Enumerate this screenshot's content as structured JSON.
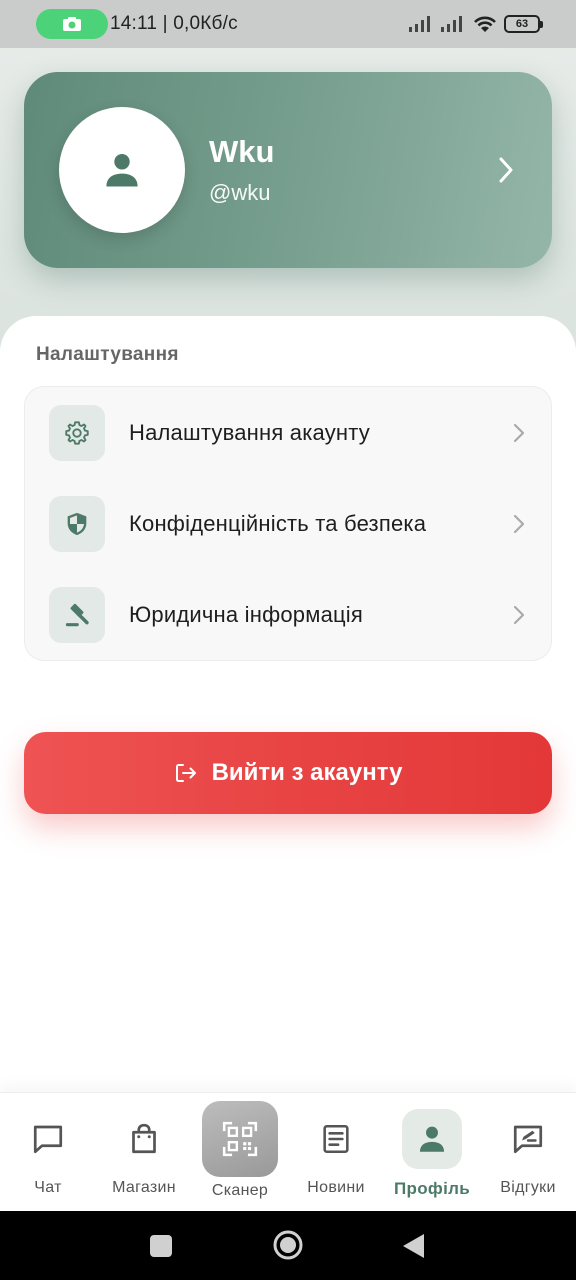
{
  "status_bar": {
    "time_and_speed": "14:11 | 0,0Кб/с",
    "battery": "63"
  },
  "profile": {
    "name": "Wku",
    "handle": "@wku"
  },
  "settings": {
    "section_title": "Налаштування",
    "items": [
      {
        "label": "Налаштування акаунту",
        "icon": "gear-icon"
      },
      {
        "label": "Конфіденційність та безпека",
        "icon": "shield-icon"
      },
      {
        "label": "Юридична інформація",
        "icon": "gavel-icon"
      }
    ]
  },
  "logout": {
    "label": "Вийти з акаунту",
    "icon": "logout-icon"
  },
  "bottom_nav": {
    "items": [
      {
        "label": "Чат",
        "icon": "chat-icon"
      },
      {
        "label": "Магазин",
        "icon": "shopping-bag-icon"
      },
      {
        "label": "Сканер",
        "icon": "qr-code-icon"
      },
      {
        "label": "Новини",
        "icon": "news-icon"
      },
      {
        "label": "Профіль",
        "icon": "person-icon",
        "active": true
      },
      {
        "label": "Відгуки",
        "icon": "feedback-icon"
      }
    ]
  },
  "colors": {
    "accent": "#4d7a68",
    "profile_card": "#6f9584",
    "logout": "#e84444"
  }
}
